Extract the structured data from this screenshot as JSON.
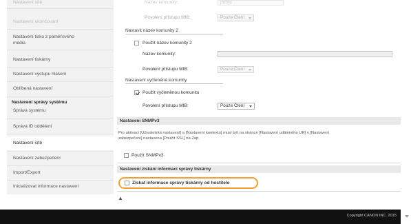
{
  "sidebar": {
    "items": [
      {
        "label": "Nastavení sítě",
        "state": "faded"
      },
      {
        "label": "Nastavení ukončování",
        "state": "faded"
      },
      {
        "label": "Nastavení tisku z paměťového",
        "label2": "média",
        "state": "normal"
      },
      {
        "label": "Nastavení tiskárny",
        "state": "normal"
      },
      {
        "label": "Nastavení výstupu hlášení",
        "state": "normal"
      },
      {
        "label": "Oblíbená nastavení",
        "state": "normal"
      },
      {
        "label": "Správa systému",
        "state": "normal"
      },
      {
        "label": "Správa ID oddělení",
        "state": "normal"
      },
      {
        "label": "Nastavení sítě",
        "state": "active"
      },
      {
        "label": "Nastavení zabezpečení",
        "state": "normal"
      },
      {
        "label": "Import/Export",
        "state": "normal"
      },
      {
        "label": "Inicializovat informace nastavení",
        "state": "normal"
      }
    ],
    "section_title": "Nastavení správy systému"
  },
  "main": {
    "faded_top": {
      "name_label": "Název komunity:",
      "name_value": "public"
    },
    "community1": {
      "mib_label": "Povolení přístupu MIB:",
      "mib_value": "Pouze Čtení"
    },
    "community2": {
      "header": "Nastavit název komunity 2",
      "use_label": "Použít název komunity 2",
      "use_checked": false,
      "name_label": "Název komunity:",
      "name_value": "",
      "mib_label": "Povolení přístupu MIB:",
      "mib_value": "Pouze Čtení"
    },
    "dedicated": {
      "header": "Nastavení vyčleněné komunity",
      "use_label": "Použít vyčleněnou komunitu",
      "use_checked": true,
      "mib_label": "Povolení přístupu MIB:",
      "mib_value": "Pouze Čtení"
    },
    "snmpv3": {
      "band": "Nastavení SNMPv3",
      "info_line1": "Pro aktivaci [Uživatelská nastavení] a [Nastavení kontextu] musí být na stránce [Nastavení událeného UR] v [Nastavení",
      "info_line2": "zabezpečení] nastavena [Použít SSL] na Zap.",
      "use_label": "Použít SNMPv3",
      "use_checked": false
    },
    "printer_mgmt": {
      "band": "Nastavení získání informací správy tiskárny",
      "get_label": "Získat informace správy tiskárny od hostitele",
      "get_checked": false
    },
    "top_link": "▲"
  },
  "footer": {
    "copyright": "Copyright CANON INC. 2015"
  },
  "colors": {
    "highlight": "#f0a030",
    "footer_bg": "#111111",
    "sidebar_bg": "#f2f2f2"
  }
}
